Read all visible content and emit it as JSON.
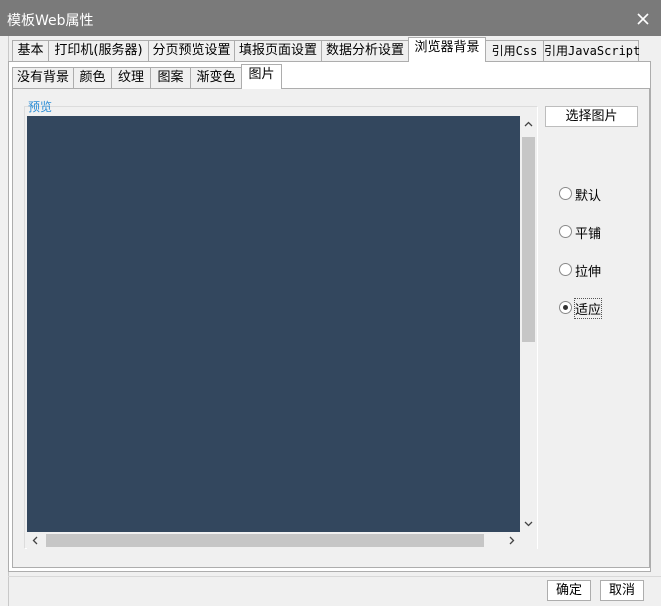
{
  "window": {
    "title": "模板Web属性"
  },
  "main_tabs": [
    {
      "label": "基本"
    },
    {
      "label": "打印机(服务器)"
    },
    {
      "label": "分页预览设置"
    },
    {
      "label": "填报页面设置"
    },
    {
      "label": "数据分析设置"
    },
    {
      "label": "浏览器背景"
    },
    {
      "label": "引用Css"
    },
    {
      "label": "引用JavaScript"
    }
  ],
  "main_tabs_active": "浏览器背景",
  "sub_tabs": [
    {
      "label": "没有背景"
    },
    {
      "label": "颜色"
    },
    {
      "label": "纹理"
    },
    {
      "label": "图案"
    },
    {
      "label": "渐变色"
    },
    {
      "label": "图片"
    }
  ],
  "sub_tabs_active": "图片",
  "preview": {
    "label": "预览",
    "background_color": "#33475e"
  },
  "select_image_button": "选择图片",
  "layout_options": [
    {
      "label": "默认",
      "checked": false
    },
    {
      "label": "平铺",
      "checked": false
    },
    {
      "label": "拉伸",
      "checked": false
    },
    {
      "label": "适应",
      "checked": true
    }
  ],
  "footer": {
    "ok_label": "确定",
    "cancel_label": "取消"
  },
  "icons": {
    "close": "close-icon",
    "scroll_up": "chevron-up-icon",
    "scroll_down": "chevron-down-icon",
    "scroll_left": "chevron-left-icon",
    "scroll_right": "chevron-right-icon"
  }
}
